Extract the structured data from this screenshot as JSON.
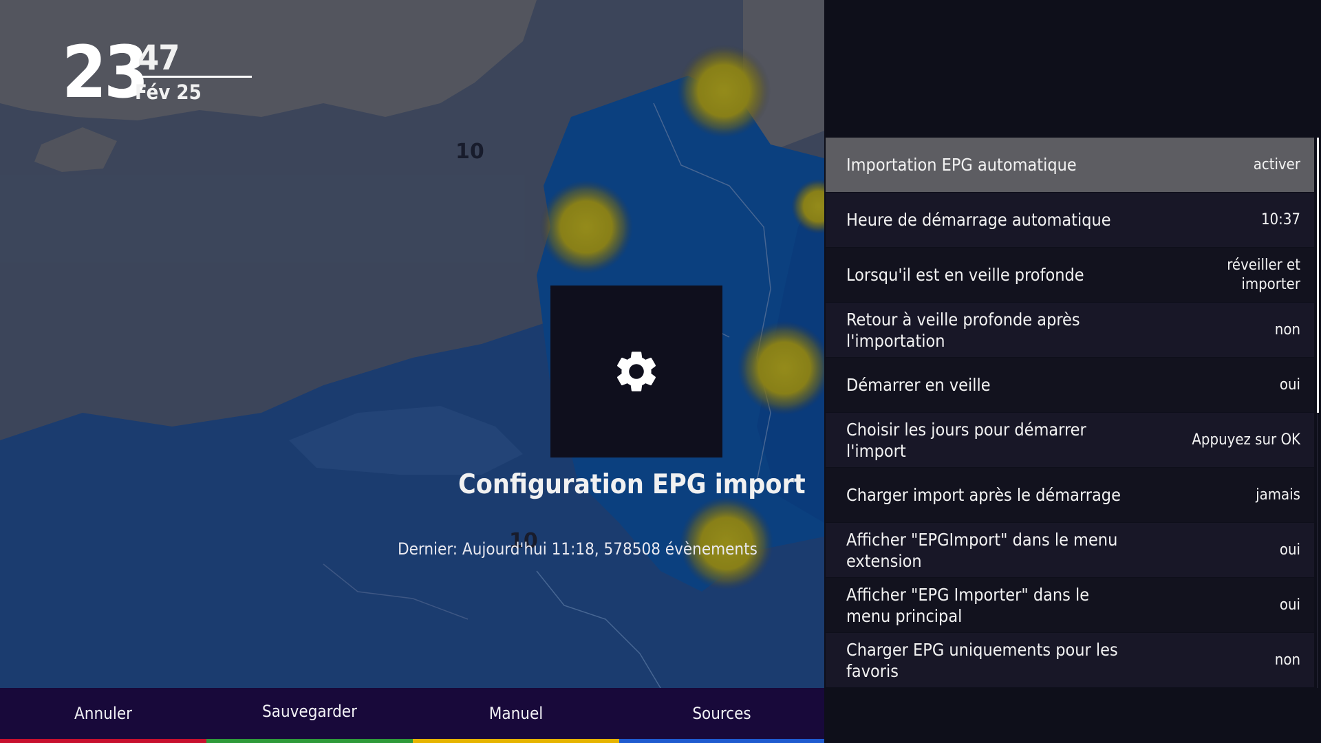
{
  "clock": {
    "hour": "23",
    "minute": "47",
    "date": "Fév 25"
  },
  "map": {
    "labels": [
      "10",
      "10"
    ]
  },
  "screen": {
    "title": "Configuration EPG import",
    "last_import": "Dernier: Aujourd'hui 11:18, 578508 évènements",
    "icon": "gear-icon"
  },
  "settings": [
    {
      "label": "Importation EPG automatique",
      "value": "activer"
    },
    {
      "label": "Heure de démarrage automatique",
      "value": "10:37"
    },
    {
      "label": "Lorsqu'il est en veille profonde",
      "value": "réveiller et importer"
    },
    {
      "label": "Retour à veille profonde après l'importation",
      "value": "non"
    },
    {
      "label": "Démarrer en veille",
      "value": "oui"
    },
    {
      "label": "Choisir les jours pour démarrer l'import",
      "value": "Appuyez sur OK"
    },
    {
      "label": "Charger import après le démarrage",
      "value": "jamais"
    },
    {
      "label": "Afficher \"EPGImport\" dans le menu extension",
      "value": "oui"
    },
    {
      "label": "Afficher \"EPG Importer\" dans le menu principal",
      "value": "oui"
    },
    {
      "label": "Charger EPG uniquements pour les favoris",
      "value": "non"
    }
  ],
  "buttons": {
    "cancel": "Annuler",
    "save": "Sauvegarder",
    "manual": "Manuel",
    "sources": "Sources"
  },
  "colors": {
    "red": "#c8102e",
    "green": "#2e9a3a",
    "yellow": "#e6b400",
    "blue": "#1f5bd0",
    "selected_row": "#5d5d62",
    "bottom_bar": "#18093a"
  }
}
